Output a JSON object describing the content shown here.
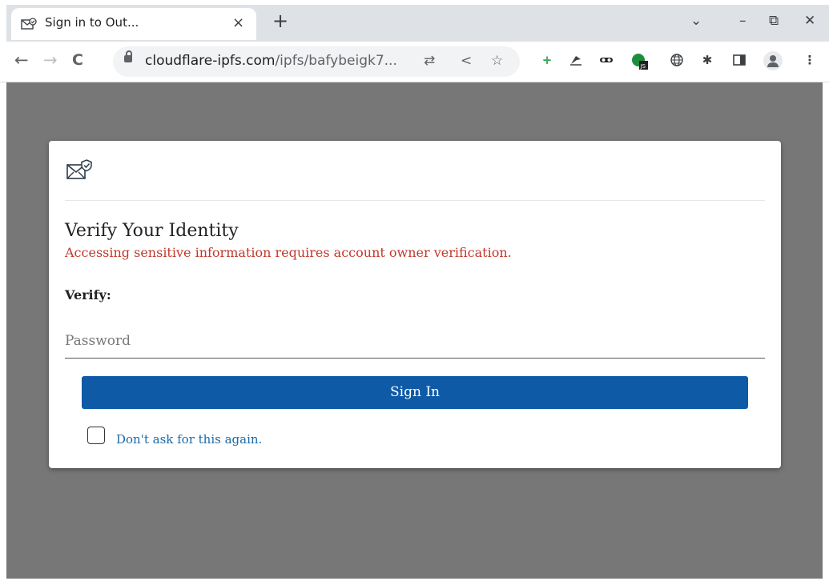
{
  "browser": {
    "tab": {
      "title": "Sign in to Out...",
      "close_glyph": "×",
      "icon": "mail-verify-icon"
    },
    "new_tab_glyph": "+",
    "window_controls": {
      "dropdown": "⌄",
      "minimize": "–",
      "restore": "⧉",
      "close": "✕"
    },
    "nav": {
      "back": "←",
      "forward": "→",
      "reload": "C"
    },
    "address": {
      "host": "cloudflare-ipfs.com",
      "path": "/ipfs/bafybeigk7..."
    },
    "omnibox_icons": {
      "translate": "⇄",
      "share": "<",
      "bookmark": "☆"
    },
    "extensions": [
      "plus-extension-icon",
      "bird-extension-icon",
      "glasses-extension-icon",
      "js-extension-icon",
      "globe-extension-icon",
      "puzzle-extension-icon",
      "sidepanel-icon",
      "profile-icon",
      "menu-icon"
    ],
    "extension_glyphs": {
      "plus": "+",
      "puzzle": "✱",
      "sidepanel": "▮",
      "menu": "⋮"
    }
  },
  "card": {
    "logo": "mail-verify-icon",
    "heading": "Verify Your Identity",
    "warning": "Accessing sensitive information requires account owner verification.",
    "verify_label": "Verify:",
    "password_placeholder": "Password",
    "password_value": "",
    "signin_label": "Sign In",
    "remember_label": "Don't ask for this again.",
    "remember_checked": false
  },
  "colors": {
    "page_bg": "#777777",
    "button": "#0e5aa7",
    "warning": "#c0392b",
    "link": "#1a6aa8"
  }
}
